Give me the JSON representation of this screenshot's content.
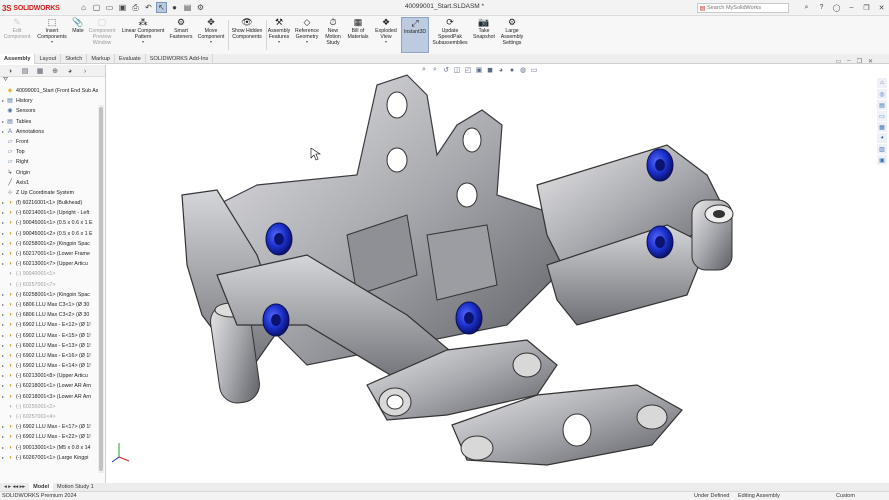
{
  "app": {
    "logo_ds": "3S",
    "logo_text": "SOLIDWORKS",
    "document_title": "40099001_Start.SLDASM *"
  },
  "search": {
    "placeholder": "Search MySolidWorks"
  },
  "quick_access": [
    "home-icon",
    "new-icon",
    "open-icon",
    "save-icon",
    "print-icon",
    "select-icon",
    "rebuild-icon",
    "file-properties-icon",
    "options-icon"
  ],
  "commands": [
    {
      "label": "Edit Component",
      "icon": "edit-component-icon",
      "disabled": true
    },
    {
      "label": "Insert Components",
      "icon": "insert-components-icon"
    },
    {
      "label": "Mate",
      "icon": "mate-icon"
    },
    {
      "label": "Component Preview Window",
      "icon": "preview-window-icon",
      "disabled": true
    },
    {
      "label": "Linear Component Pattern",
      "icon": "pattern-icon"
    },
    {
      "label": "Smart Fasteners",
      "icon": "fasteners-icon"
    },
    {
      "label": "Move Component",
      "icon": "move-icon"
    },
    {
      "label": "Show Hidden Components",
      "icon": "show-hidden-icon"
    },
    {
      "label": "Assembly Features",
      "icon": "assembly-features-icon"
    },
    {
      "label": "Reference Geometry",
      "icon": "reference-geometry-icon"
    },
    {
      "label": "New Motion Study",
      "icon": "motion-study-icon"
    },
    {
      "label": "Bill of Materials",
      "icon": "bom-icon"
    },
    {
      "label": "Exploded View",
      "icon": "exploded-view-icon"
    },
    {
      "label": "Instant3D",
      "icon": "instant3d-icon",
      "active": true
    },
    {
      "label": "Update SpeedPak Subassemblies",
      "icon": "speedpak-icon"
    },
    {
      "label": "Take Snapshot",
      "icon": "snapshot-icon"
    },
    {
      "label": "Large Assembly Settings",
      "icon": "large-assembly-icon"
    }
  ],
  "tabs": [
    "Assembly",
    "Layout",
    "Sketch",
    "Markup",
    "Evaluate",
    "SOLIDWORKS Add-Ins"
  ],
  "tree": [
    {
      "label": "40099001_Start (Front End Sub Asse",
      "icon": "assembly",
      "exp": ""
    },
    {
      "label": "History",
      "icon": "folder",
      "exp": "▸"
    },
    {
      "label": "Sensors",
      "icon": "sensor",
      "exp": ""
    },
    {
      "label": "Tables",
      "icon": "folder",
      "exp": "▸"
    },
    {
      "label": "Annotations",
      "icon": "annotation",
      "exp": "▸"
    },
    {
      "label": "Front",
      "icon": "plane",
      "exp": ""
    },
    {
      "label": "Top",
      "icon": "plane",
      "exp": ""
    },
    {
      "label": "Right",
      "icon": "plane",
      "exp": ""
    },
    {
      "label": "Origin",
      "icon": "origin",
      "exp": ""
    },
    {
      "label": "Axis1",
      "icon": "axis",
      "exp": ""
    },
    {
      "label": "Z Up Coordinate System",
      "icon": "coordinate",
      "exp": ""
    },
    {
      "label": "(f) 60216001<1> (Bulkhead)",
      "icon": "part",
      "exp": "▸"
    },
    {
      "label": "(-) 60214001<1> (Upright - Left",
      "icon": "part",
      "exp": "▸"
    },
    {
      "label": "(-) 90045001<1> (0.5 x 0.6 x 1 E",
      "icon": "part",
      "exp": "▸"
    },
    {
      "label": "(-) 90045001<2> (0.5 x 0.6 x 1 E",
      "icon": "part",
      "exp": "▸"
    },
    {
      "label": "(-) 60258001<2> (Kingpin Spac",
      "icon": "part",
      "exp": "▸"
    },
    {
      "label": "(-) 60217001<1> (Lower Frame",
      "icon": "part",
      "exp": "▸"
    },
    {
      "label": "(-) 60213001<7> (Upper Articu",
      "icon": "part",
      "exp": "▸"
    },
    {
      "label": "(-) 90040001<1>",
      "icon": "part",
      "exp": "",
      "grey": true
    },
    {
      "label": "(-) 60257001<7>",
      "icon": "part",
      "exp": "",
      "grey": true
    },
    {
      "label": "(-) 60258001<1> (Kingpin Spac",
      "icon": "part",
      "exp": "▸"
    },
    {
      "label": "(-) 6806 LLU Max C3<1> (Ø 30",
      "icon": "part",
      "exp": "▸"
    },
    {
      "label": "(-) 6806 LLU Max C3<2> (Ø 30",
      "icon": "part",
      "exp": "▸"
    },
    {
      "label": "(-) 6902 LLU Max - E<12> (Ø 1!",
      "icon": "part",
      "exp": "▸"
    },
    {
      "label": "(-) 6902 LLU Max - E<15> (Ø 1!",
      "icon": "part",
      "exp": "▸"
    },
    {
      "label": "(-) 6902 LLU Max - E<13> (Ø 1!",
      "icon": "part",
      "exp": "▸"
    },
    {
      "label": "(-) 6902 LLU Max - E<16> (Ø 1!",
      "icon": "part",
      "exp": "▸"
    },
    {
      "label": "(-) 6902 LLU Max - E<14> (Ø 1!",
      "icon": "part",
      "exp": "▸"
    },
    {
      "label": "(-) 60213001<8> (Upper Articu",
      "icon": "part",
      "exp": "▸"
    },
    {
      "label": "(-) 60218001<1> (Lower AR Arn",
      "icon": "part",
      "exp": "▸"
    },
    {
      "label": "(-) 60218001<3> (Lower AR Arn",
      "icon": "part",
      "exp": "▸"
    },
    {
      "label": "(-) 60255001<2>",
      "icon": "part",
      "exp": "",
      "grey": true
    },
    {
      "label": "(-) 60257001<4>",
      "icon": "part",
      "exp": "",
      "grey": true
    },
    {
      "label": "(-) 6902 LLU Max - E<17> (Ø 1!",
      "icon": "part",
      "exp": "▸"
    },
    {
      "label": "(-) 6902 LLU Max - E<22> (Ø 1!",
      "icon": "part",
      "exp": "▸"
    },
    {
      "label": "(-) 90013001<1> (M5 x 0.8 x 14",
      "icon": "part",
      "exp": "▸"
    },
    {
      "label": "(-) 60267001<1> (Large Kingpi",
      "icon": "part",
      "exp": "▸"
    }
  ],
  "bottom_tabs": [
    "Model",
    "Motion Study 1"
  ],
  "status": {
    "left": "SOLIDWORKS Premium 2024",
    "definition": "Under Defined",
    "mode": "Editing Assembly",
    "units": "Custom"
  },
  "colors": {
    "accent_red": "#d11c1c",
    "bearing_blue": "#1a2fc8",
    "selection_blue": "#bccbe0"
  }
}
